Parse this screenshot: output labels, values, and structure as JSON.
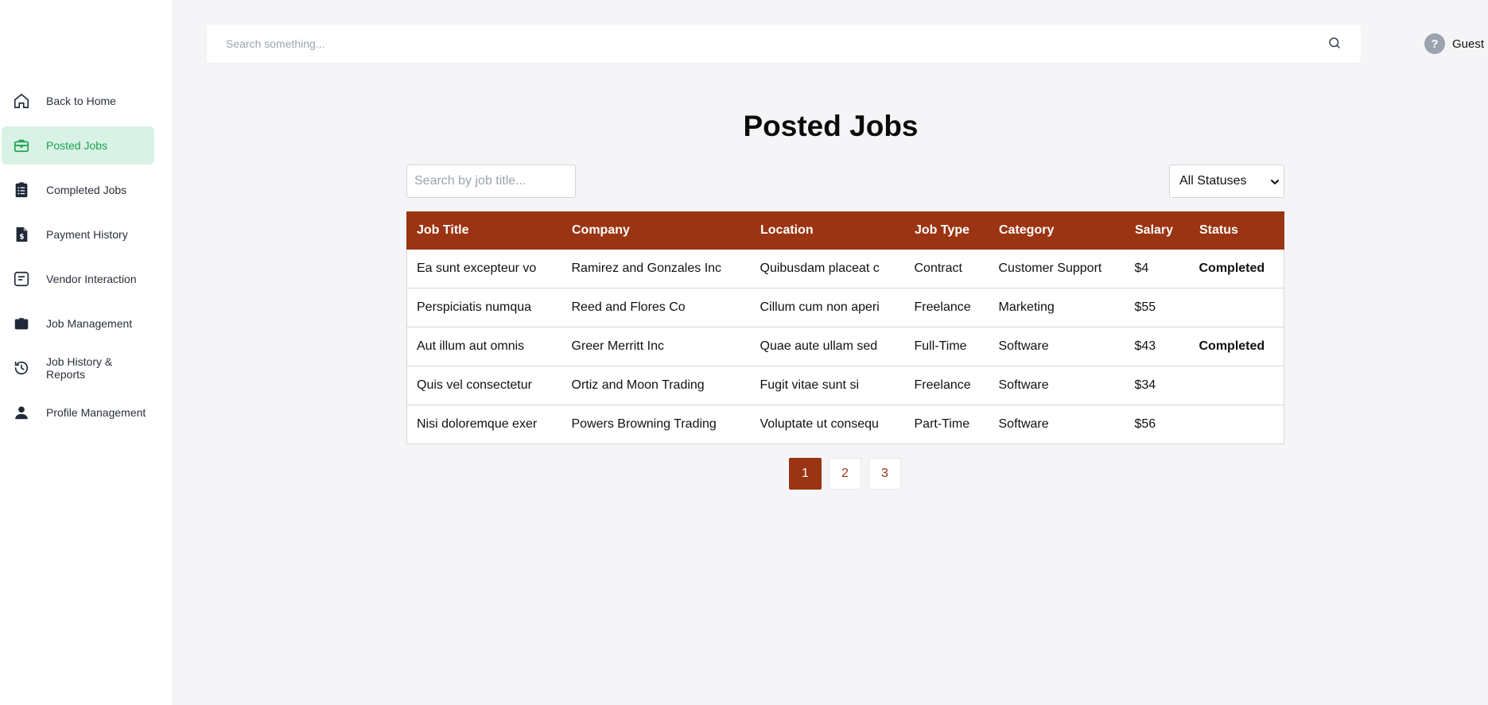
{
  "sidebar": {
    "items": [
      {
        "label": "Back to Home",
        "icon": "home-icon"
      },
      {
        "label": "Posted Jobs",
        "icon": "briefcase-icon",
        "active": true
      },
      {
        "label": "Completed Jobs",
        "icon": "clipboard-list-icon"
      },
      {
        "label": "Payment History",
        "icon": "file-dollar-icon"
      },
      {
        "label": "Vendor Interaction",
        "icon": "message-square-icon"
      },
      {
        "label": "Job Management",
        "icon": "briefcase-solid-icon"
      },
      {
        "label": "Job History & Reports",
        "icon": "history-icon"
      },
      {
        "label": "Profile Management",
        "icon": "user-icon"
      }
    ]
  },
  "header": {
    "search_placeholder": "Search something...",
    "user_name": "Guest",
    "avatar_glyph": "?"
  },
  "main": {
    "title": "Posted Jobs",
    "job_search_placeholder": "Search by job title...",
    "status_filter": "All Statuses",
    "columns": [
      "Job Title",
      "Company",
      "Location",
      "Job Type",
      "Category",
      "Salary",
      "Status"
    ],
    "rows": [
      [
        "Ea sunt excepteur vo",
        "Ramirez and Gonzales Inc",
        "Quibusdam placeat c",
        "Contract",
        "Customer Support",
        "$4",
        "Completed"
      ],
      [
        "Perspiciatis numqua",
        "Reed and Flores Co",
        "Cillum cum non aperi",
        "Freelance",
        "Marketing",
        "$55",
        ""
      ],
      [
        "Aut illum aut omnis",
        "Greer Merritt Inc",
        "Quae aute ullam sed",
        "Full-Time",
        "Software",
        "$43",
        "Completed"
      ],
      [
        "Quis vel consectetur",
        "Ortiz and Moon Trading",
        "Fugit vitae sunt si",
        "Freelance",
        "Software",
        "$34",
        ""
      ],
      [
        "Nisi doloremque exer",
        "Powers Browning Trading",
        "Voluptate ut consequ",
        "Part-Time",
        "Software",
        "$56",
        ""
      ]
    ],
    "pages": [
      "1",
      "2",
      "3"
    ],
    "current_page": "1"
  },
  "colors": {
    "accent": "#9a3412",
    "active_nav_bg": "#d9f2e6",
    "success": "#16a34a"
  }
}
